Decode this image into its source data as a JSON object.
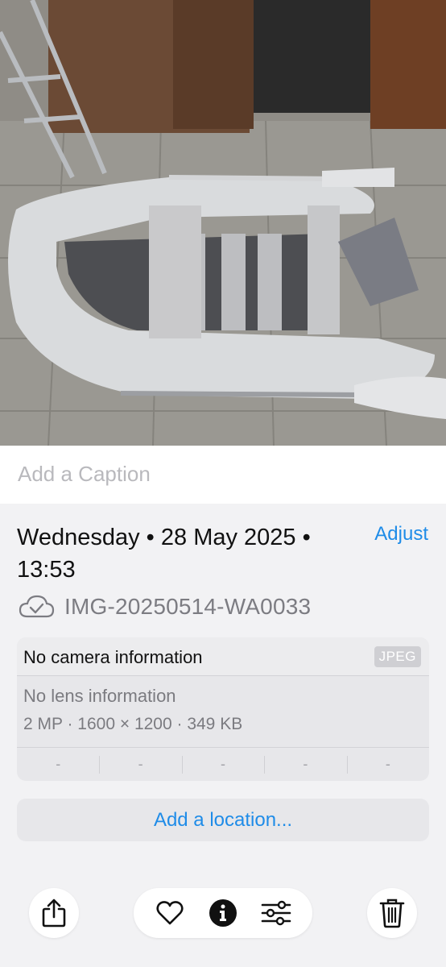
{
  "photo": {
    "description_icon": "photo-image"
  },
  "caption": {
    "placeholder": "Add a Caption"
  },
  "details": {
    "date_line": "Wednesday • 28 May 2025 • 13:53",
    "adjust_label": "Adjust",
    "filename": "IMG-20250514-WA0033",
    "cloud_icon": "cloud-check-icon"
  },
  "metadata": {
    "camera": "No camera information",
    "format_badge": "JPEG",
    "lens": "No lens information",
    "specs": "2 MP · 1600 × 1200 · 349 KB",
    "exif": [
      "-",
      "-",
      "-",
      "-",
      "-"
    ]
  },
  "location": {
    "label": "Add a location..."
  },
  "toolbar": {
    "share_icon": "share-icon",
    "favorite_icon": "heart-icon",
    "info_icon": "info-icon",
    "edit_icon": "sliders-icon",
    "delete_icon": "trash-icon"
  },
  "colors": {
    "accent": "#1f8ce8",
    "background": "#f2f2f4",
    "card": "#e7e7ea"
  }
}
